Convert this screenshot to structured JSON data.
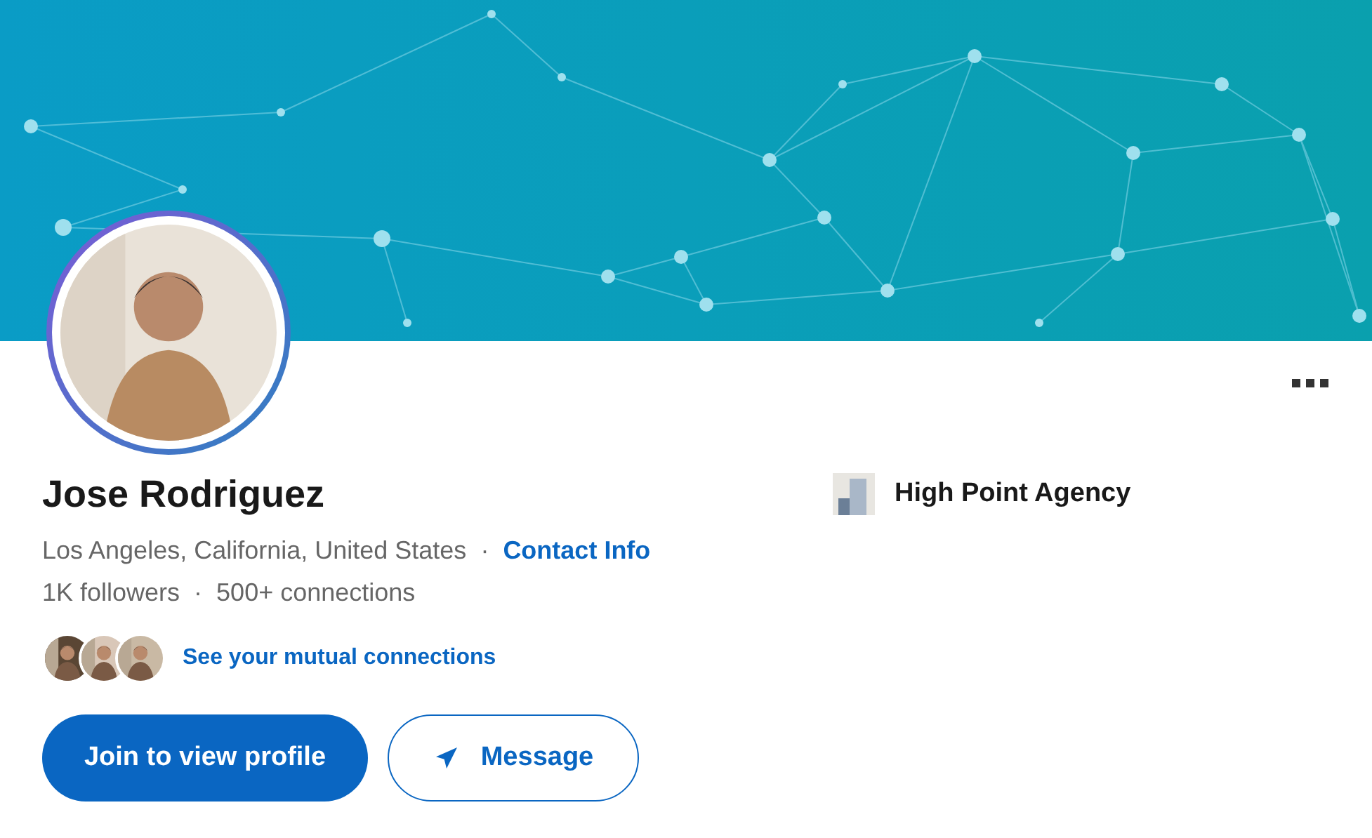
{
  "name": "Jose Rodriguez",
  "location_line": {
    "location": "Los Angeles, California, United States",
    "separator": "·",
    "contact_link": "Contact Info"
  },
  "stats_line": {
    "followers": "1K followers",
    "separator": "·",
    "connections": "500+ connections"
  },
  "mutual": {
    "link": "See your mutual connections"
  },
  "company": "High Point Agency",
  "buttons": [
    {
      "label": "Join to view profile",
      "kind": "primary"
    },
    {
      "label": "Message",
      "kind": "secondary"
    }
  ]
}
